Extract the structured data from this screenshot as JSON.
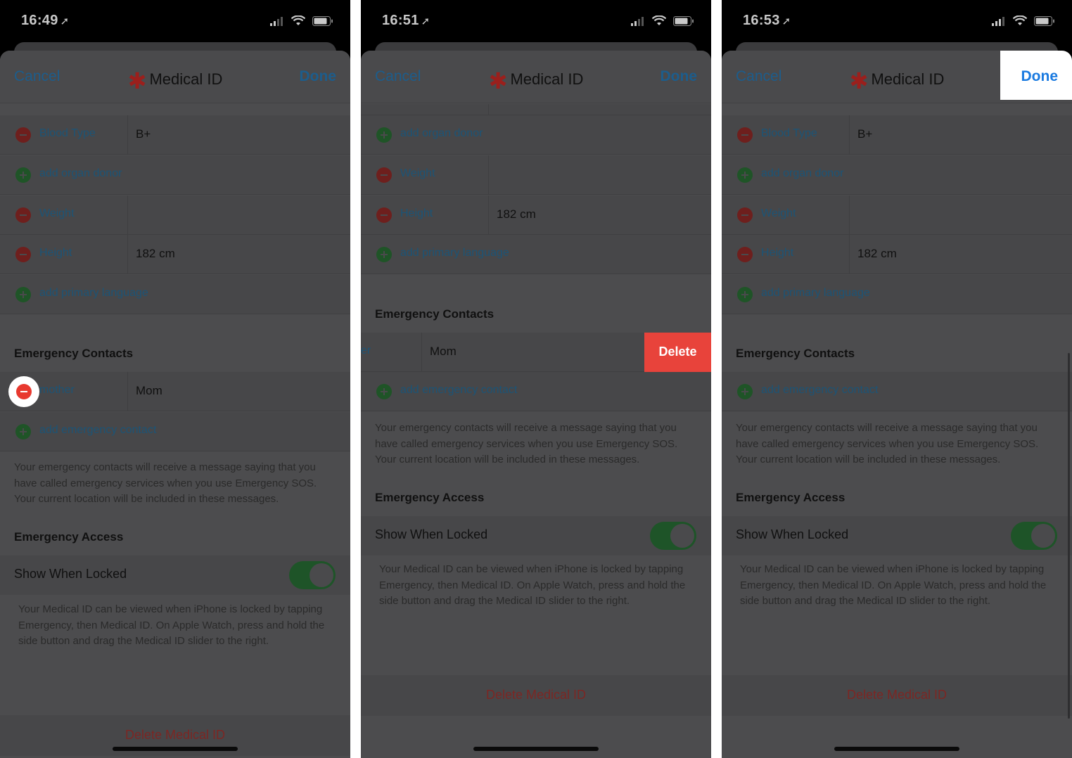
{
  "screens": [
    {
      "status": {
        "time": "16:49"
      },
      "nav": {
        "cancel": "Cancel",
        "title": "Medical ID",
        "done": "Done"
      },
      "rows": [
        {
          "type": "minus",
          "label": "Blood Type",
          "value": "B+"
        },
        {
          "type": "plus",
          "label": "add organ donor"
        },
        {
          "type": "minus",
          "label": "Weight",
          "value": ""
        },
        {
          "type": "minus",
          "label": "Height",
          "value": "182 cm"
        },
        {
          "type": "plus",
          "label": "add primary language"
        }
      ],
      "emergency_header": "Emergency Contacts",
      "contact": {
        "label": "mother",
        "value": "Mom"
      },
      "add_contact": "add emergency contact",
      "contacts_note": "Your emergency contacts will receive a message saying that you have called emergency services when you use Emergency SOS. Your current location will be included in these messages.",
      "access_header": "Emergency Access",
      "show_when_locked": "Show When Locked",
      "toggle_on": true,
      "access_note": "Your Medical ID can be viewed when iPhone is locked by tapping Emergency, then Medical ID. On Apple Watch, press and hold the side button and drag the Medical ID slider to the right.",
      "delete_medical_id": "Delete Medical ID"
    },
    {
      "status": {
        "time": "16:51"
      },
      "nav": {
        "cancel": "Cancel",
        "title": "Medical ID",
        "done": "Done"
      },
      "rows": [
        {
          "type": "plus",
          "label": "add organ donor"
        },
        {
          "type": "minus",
          "label": "Weight",
          "value": ""
        },
        {
          "type": "minus",
          "label": "Height",
          "value": "182 cm"
        },
        {
          "type": "plus",
          "label": "add primary language"
        }
      ],
      "emergency_header": "Emergency Contacts",
      "contact": {
        "label": "er",
        "value": "Mom",
        "delete_action": "Delete"
      },
      "add_contact": "add emergency contact",
      "contacts_note": "Your emergency contacts will receive a message saying that you have called emergency services when you use Emergency SOS. Your current location will be included in these messages.",
      "access_header": "Emergency Access",
      "show_when_locked": "Show When Locked",
      "toggle_on": true,
      "access_note": "Your Medical ID can be viewed when iPhone is locked by tapping Emergency, then Medical ID. On Apple Watch, press and hold the side button and drag the Medical ID slider to the right.",
      "delete_medical_id": "Delete Medical ID"
    },
    {
      "status": {
        "time": "16:53"
      },
      "nav": {
        "cancel": "Cancel",
        "title": "Medical ID",
        "done": "Done"
      },
      "rows": [
        {
          "type": "minus",
          "label": "Blood Type",
          "value": "B+"
        },
        {
          "type": "plus",
          "label": "add organ donor"
        },
        {
          "type": "minus",
          "label": "Weight",
          "value": ""
        },
        {
          "type": "minus",
          "label": "Height",
          "value": "182 cm"
        },
        {
          "type": "plus",
          "label": "add primary language"
        }
      ],
      "emergency_header": "Emergency Contacts",
      "add_contact": "add emergency contact",
      "contacts_note": "Your emergency contacts will receive a message saying that you have called emergency services when you use Emergency SOS. Your current location will be included in these messages.",
      "access_header": "Emergency Access",
      "show_when_locked": "Show When Locked",
      "toggle_on": true,
      "access_note": "Your Medical ID can be viewed when iPhone is locked by tapping Emergency, then Medical ID. On Apple Watch, press and hold the side button and drag the Medical ID slider to the right.",
      "delete_medical_id": "Delete Medical ID"
    }
  ],
  "colors": {
    "nav_link": "#1c5d8c",
    "done_highlight": "#1a7ae0",
    "delete_red": "#e8433b",
    "toggle_green": "#1e5428"
  },
  "icons": [
    "location-arrow-icon",
    "cellular-signal-icon",
    "wifi-icon",
    "battery-icon",
    "medical-star-icon",
    "minus-circle-icon",
    "plus-circle-icon"
  ]
}
